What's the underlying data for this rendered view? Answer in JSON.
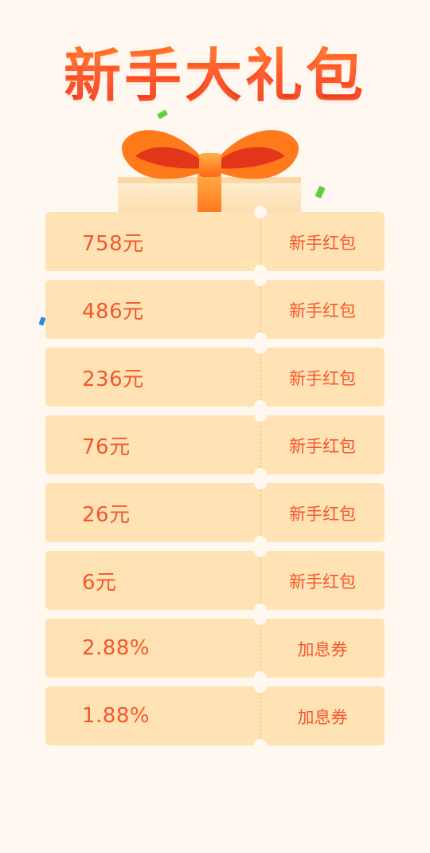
{
  "header": {
    "title": "新手大礼包"
  },
  "icons": {
    "gift": "gift-box-icon"
  },
  "colors": {
    "accent": "#f5572b",
    "coupon_bg": "#ffe3b5",
    "page_bg": "#fff8f1"
  },
  "coupons": [
    {
      "amount": "758元",
      "type": "新手红包"
    },
    {
      "amount": "486元",
      "type": "新手红包"
    },
    {
      "amount": "236元",
      "type": "新手红包"
    },
    {
      "amount": "76元",
      "type": "新手红包"
    },
    {
      "amount": "26元",
      "type": "新手红包"
    },
    {
      "amount": "6元",
      "type": "新手红包"
    },
    {
      "amount": "2.88%",
      "type": "加息券"
    },
    {
      "amount": "1.88%",
      "type": "加息券"
    }
  ]
}
